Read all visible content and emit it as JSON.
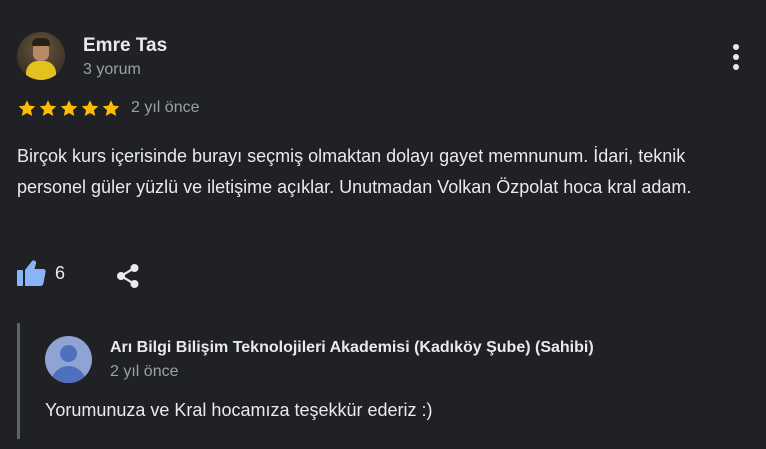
{
  "review": {
    "author_name": "Emre Tas",
    "author_meta": "3 yorum",
    "rating": 5,
    "rating_max": 5,
    "date": "2 yıl önce",
    "text": "Birçok kurs içerisinde burayı seçmiş olmaktan dolayı gayet memnunum. İdari, teknik personel güler yüzlü ve iletişime açıklar. Unutmadan Volkan Özpolat hoca kral adam.",
    "like_count": "6",
    "icons": {
      "avatar": "user-photo-avatar",
      "more": "more-vert-icon",
      "star": "star-icon",
      "like": "thumbs-up-icon",
      "share": "share-icon"
    }
  },
  "reply": {
    "owner_name": "Arı Bilgi Bilişim Teknolojileri Akademisi (Kadıköy Şube) (Sahibi)",
    "date": "2 yıl önce",
    "text": "Yorumunuza ve Kral hocamıza teşekkür ederiz :)",
    "icons": {
      "avatar": "default-user-avatar"
    }
  },
  "colors": {
    "background": "#202124",
    "text_primary": "#e8eaed",
    "text_secondary": "#9aa0a6",
    "star": "#fbbc04",
    "like_icon": "#8ab4f8",
    "reply_border": "#5f6368"
  }
}
